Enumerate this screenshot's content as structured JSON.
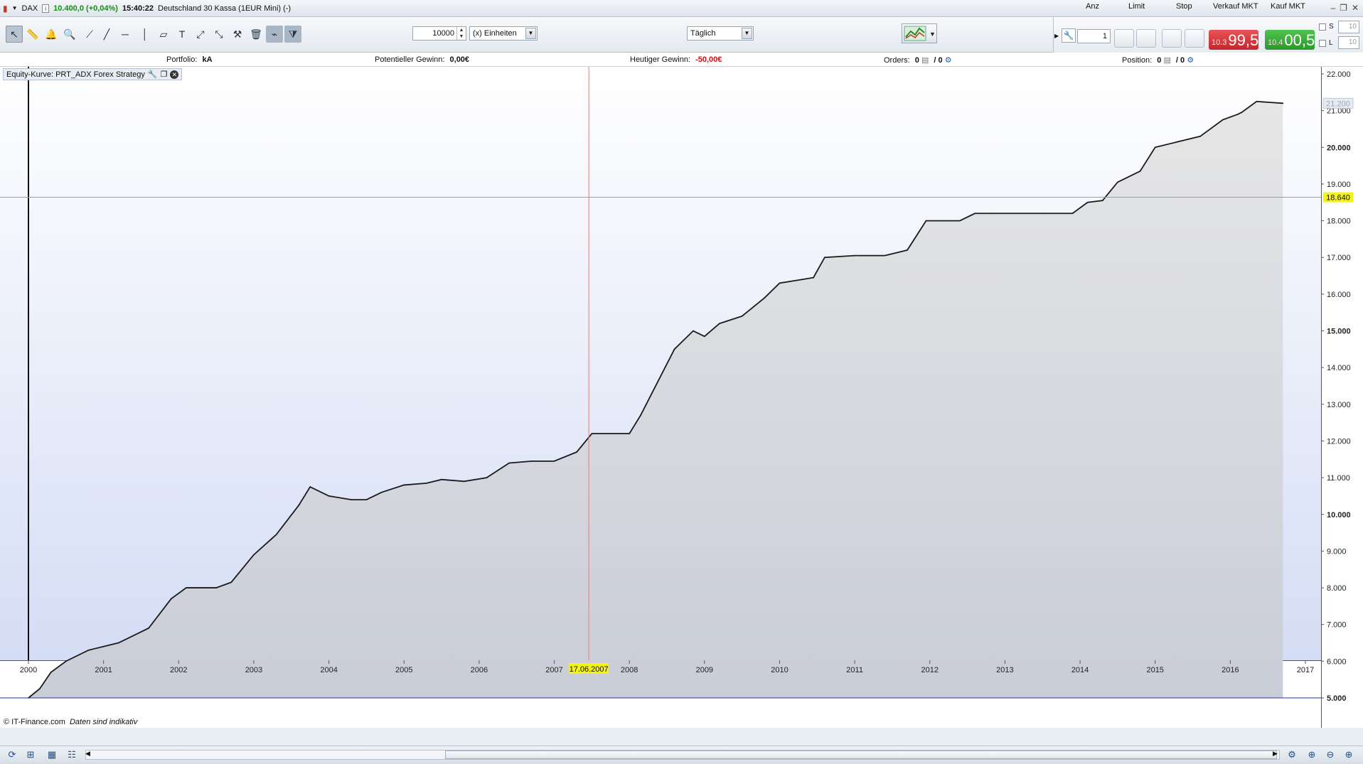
{
  "title_bar": {
    "instrument": "DAX",
    "price_change": "10.400,0 (+0,04%)",
    "time": "15:40:22",
    "instrument_name": "Deutschland 30 Kassa (1EUR Mini) (-)",
    "info_glyph": "i"
  },
  "toolbar": {
    "quantity": "10000",
    "unit": "(x) Einheiten",
    "timeframe": "Täglich"
  },
  "order_panel": {
    "qty_label": "Anz",
    "qty_value": "1",
    "limit_label": "Limit",
    "stop_label": "Stop",
    "sell_label": "Verkauf MKT",
    "sell_small": "10.3",
    "sell_big": "99,5",
    "buy_label": "Kauf MKT",
    "buy_small": "10.4",
    "buy_big": "00,5",
    "s_label": "S",
    "l_label": "L",
    "s_value": "10",
    "l_value": "10"
  },
  "info_bar": {
    "portfolio_label": "Portfolio:",
    "portfolio_value": "kA",
    "potential_label": "Potentieller Gewinn:",
    "potential_value": "0,00€",
    "today_label": "Heutiger Gewinn:",
    "today_value": "-50,00€",
    "orders_label": "Orders:",
    "orders_value": "0",
    "orders_sep": "/ 0",
    "position_label": "Position:",
    "position_value": "0",
    "position_sep": "/ 0"
  },
  "indicator_tag": "Equity-Kurve: PRT_ADX Forex Strategy",
  "copyright": "© IT-Finance.com",
  "copyright_note": "Daten sind indikativ",
  "chart_data": {
    "type": "area",
    "series": [
      {
        "x": [
          2000.0,
          2000.15,
          2000.3,
          2000.5,
          2000.8,
          2001.2,
          2001.6,
          2001.9,
          2002.1,
          2002.5,
          2002.7,
          2003.0,
          2003.3,
          2003.6,
          2003.75,
          2004.0,
          2004.3,
          2004.5,
          2004.7,
          2005.0,
          2005.3,
          2005.5,
          2005.8,
          2006.1,
          2006.4,
          2006.7,
          2007.0,
          2007.3,
          2007.5,
          2007.6,
          2007.75,
          2008.0,
          2008.15,
          2008.3,
          2008.6,
          2008.85,
          2009.0,
          2009.2,
          2009.5,
          2009.8,
          2010.0,
          2010.3,
          2010.45,
          2010.6,
          2011.0,
          2011.4,
          2011.7,
          2011.95,
          2012.4,
          2012.6,
          2013.0,
          2013.5,
          2013.9,
          2014.1,
          2014.3,
          2014.5,
          2014.8,
          2015.0,
          2015.3,
          2015.6,
          2015.9,
          2016.1,
          2016.15,
          2016.35,
          2016.7
        ],
        "y": [
          5000,
          5250,
          5700,
          6000,
          6300,
          6500,
          6900,
          7700,
          8000,
          8000,
          8150,
          8900,
          9450,
          10250,
          10750,
          10500,
          10400,
          10400,
          10600,
          10800,
          10850,
          10950,
          10900,
          11000,
          11400,
          11450,
          11450,
          11700,
          12200,
          12200,
          12200,
          12200,
          12700,
          13300,
          14500,
          15000,
          14850,
          15200,
          15400,
          15900,
          16300,
          16400,
          16450,
          17000,
          17050,
          17050,
          17200,
          18000,
          18000,
          18200,
          18200,
          18200,
          18200,
          18500,
          18550,
          19050,
          19350,
          20000,
          20150,
          20300,
          20750,
          20900,
          20950,
          21250,
          21200
        ]
      }
    ],
    "xlim": [
      2000,
      2017
    ],
    "ylim": [
      5000,
      22000
    ],
    "x_ticks": [
      "2000",
      "2001",
      "2002",
      "2003",
      "2004",
      "2005",
      "2006",
      "2007",
      "2008",
      "2009",
      "2010",
      "2011",
      "2012",
      "2013",
      "2014",
      "2015",
      "2016",
      "2017"
    ],
    "y_ticks": [
      "5.000",
      "6.000",
      "7.000",
      "8.000",
      "9.000",
      "10.000",
      "11.000",
      "12.000",
      "13.000",
      "14.000",
      "15.000",
      "16.000",
      "17.000",
      "18.000",
      "19.000",
      "20.000",
      "21.000",
      "22.000"
    ],
    "last_value_label": "21.200",
    "crosshair_value_label": "18.640",
    "crosshair_value": 18640,
    "crosshair_date_label": "17.06.2007",
    "crosshair_date": 2007.46,
    "baseline": 5000,
    "colors": {
      "line": "#1a1a1a",
      "fill_top": "#e6e6e6",
      "fill_bottom": "#c9cdd8",
      "background_top": "#ffffff",
      "background_bottom": "#d4ddf5",
      "crosshair": "#ef7a7a",
      "baseline": "#2233aa",
      "tag_yellow": "#f3f316"
    }
  }
}
